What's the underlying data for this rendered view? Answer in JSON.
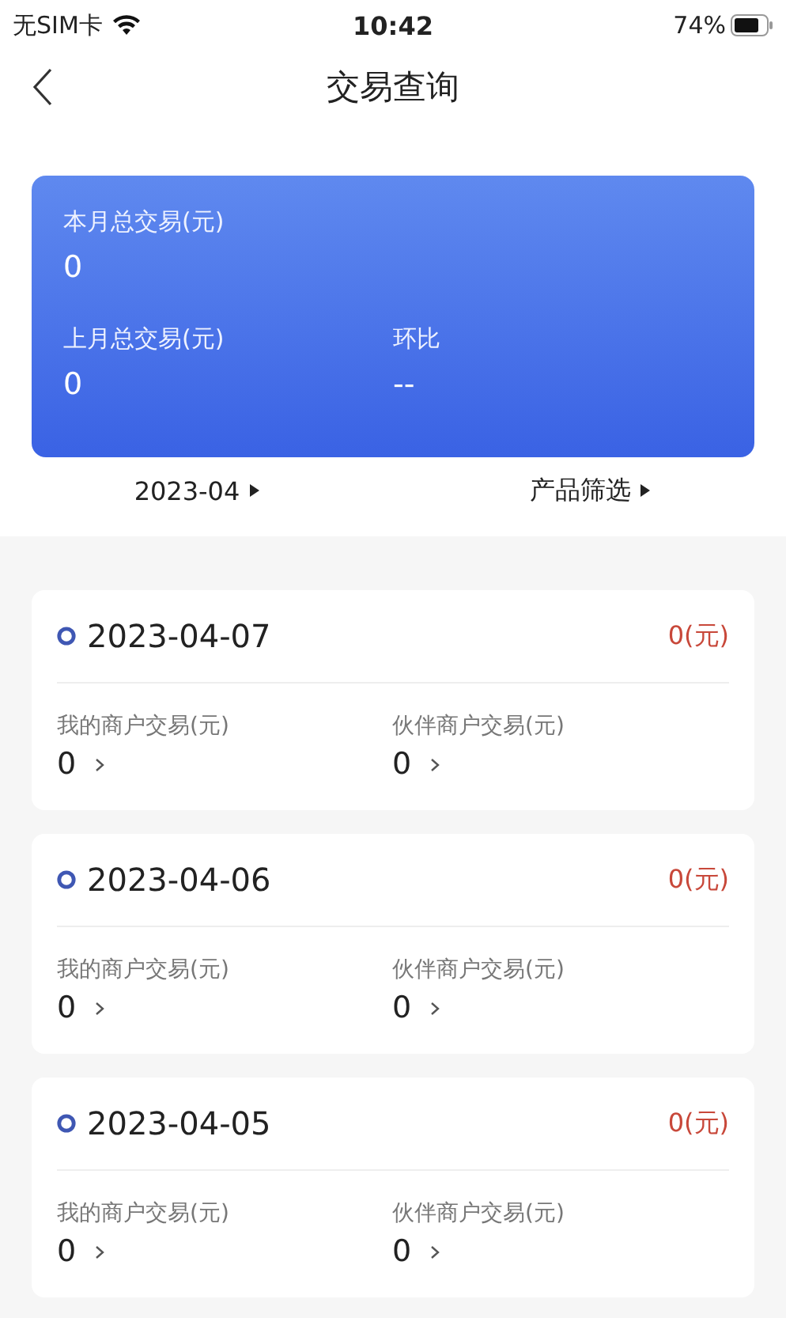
{
  "status_bar": {
    "carrier": "无SIM卡",
    "time": "10:42",
    "battery": "74%"
  },
  "nav": {
    "title": "交易查询"
  },
  "summary": {
    "this_month_label": "本月总交易(元)",
    "this_month_value": "0",
    "last_month_label": "上月总交易(元)",
    "last_month_value": "0",
    "ratio_label": "环比",
    "ratio_value": "--"
  },
  "filters": [
    {
      "label": "2023-04"
    },
    {
      "label": "产品筛选"
    }
  ],
  "days": [
    {
      "date": "2023-04-07",
      "total": "0(元)",
      "mine_label": "我的商户交易(元)",
      "mine_value": "0",
      "partner_label": "伙伴商户交易(元)",
      "partner_value": "0"
    },
    {
      "date": "2023-04-06",
      "total": "0(元)",
      "mine_label": "我的商户交易(元)",
      "mine_value": "0",
      "partner_label": "伙伴商户交易(元)",
      "partner_value": "0"
    },
    {
      "date": "2023-04-05",
      "total": "0(元)",
      "mine_label": "我的商户交易(元)",
      "mine_value": "0",
      "partner_label": "伙伴商户交易(元)",
      "partner_value": "0"
    }
  ]
}
